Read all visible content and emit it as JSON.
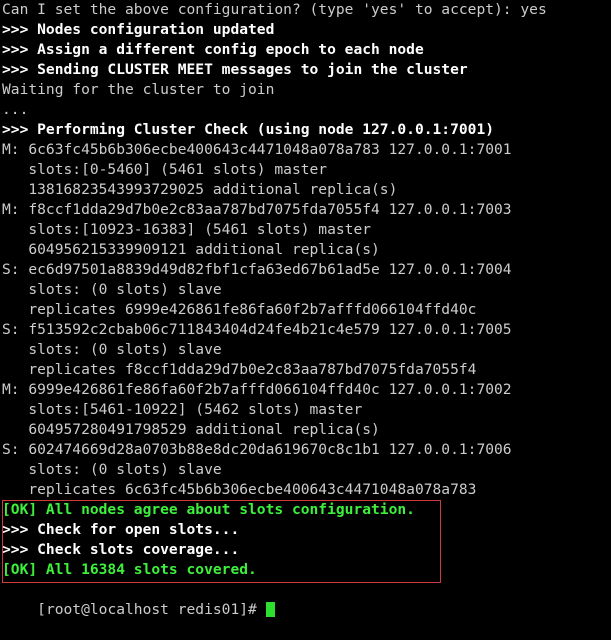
{
  "terminal": {
    "title": "redis-cluster-terminal",
    "background_color": "#000000",
    "default_text_color": "#cccccc",
    "bold_white_color": "#ffffff",
    "green_color": "#3cf03c",
    "highlight_border_color": "#d03a3a",
    "cursor_color": "#2ee02e",
    "lines": [
      {
        "id": "line-0",
        "style": "plain",
        "text": "Can I set the above configuration? (type 'yes' to accept): yes"
      },
      {
        "id": "line-1",
        "style": "white",
        "text": ">>> Nodes configuration updated"
      },
      {
        "id": "line-2",
        "style": "white",
        "text": ">>> Assign a different config epoch to each node"
      },
      {
        "id": "line-3",
        "style": "white",
        "text": ">>> Sending CLUSTER MEET messages to join the cluster"
      },
      {
        "id": "line-4",
        "style": "plain",
        "text": "Waiting for the cluster to join"
      },
      {
        "id": "line-5",
        "style": "plain",
        "text": "..."
      },
      {
        "id": "line-6",
        "style": "white",
        "text": ">>> Performing Cluster Check (using node 127.0.0.1:7001)"
      },
      {
        "id": "line-7",
        "style": "plain",
        "text": "M: 6c63fc45b6b306ecbe400643c4471048a078a783 127.0.0.1:7001"
      },
      {
        "id": "line-8",
        "style": "plain",
        "text": "   slots:[0-5460] (5461 slots) master"
      },
      {
        "id": "line-9",
        "style": "plain",
        "text": "   13816823543993729025 additional replica(s)"
      },
      {
        "id": "line-10",
        "style": "plain",
        "text": "M: f8ccf1dda29d7b0e2c83aa787bd7075fda7055f4 127.0.0.1:7003"
      },
      {
        "id": "line-11",
        "style": "plain",
        "text": "   slots:[10923-16383] (5461 slots) master"
      },
      {
        "id": "line-12",
        "style": "plain",
        "text": "   604956215339909121 additional replica(s)"
      },
      {
        "id": "line-13",
        "style": "plain",
        "text": "S: ec6d97501a8839d49d82fbf1cfa63ed67b61ad5e 127.0.0.1:7004"
      },
      {
        "id": "line-14",
        "style": "plain",
        "text": "   slots: (0 slots) slave"
      },
      {
        "id": "line-15",
        "style": "plain",
        "text": "   replicates 6999e426861fe86fa60f2b7afffd066104ffd40c"
      },
      {
        "id": "line-16",
        "style": "plain",
        "text": "S: f513592c2cbab06c711843404d24fe4b21c4e579 127.0.0.1:7005"
      },
      {
        "id": "line-17",
        "style": "plain",
        "text": "   slots: (0 slots) slave"
      },
      {
        "id": "line-18",
        "style": "plain",
        "text": "   replicates f8ccf1dda29d7b0e2c83aa787bd7075fda7055f4"
      },
      {
        "id": "line-19",
        "style": "plain",
        "text": "M: 6999e426861fe86fa60f2b7afffd066104ffd40c 127.0.0.1:7002"
      },
      {
        "id": "line-20",
        "style": "plain",
        "text": "   slots:[5461-10922] (5462 slots) master"
      },
      {
        "id": "line-21",
        "style": "plain",
        "text": "   604957280491798529 additional replica(s)"
      },
      {
        "id": "line-22",
        "style": "plain",
        "text": "S: 602474669d28a0703b88e8dc20da619670c8c1b1 127.0.0.1:7006"
      },
      {
        "id": "line-23",
        "style": "plain",
        "text": "   slots: (0 slots) slave"
      },
      {
        "id": "line-24",
        "style": "plain",
        "text": "   replicates 6c63fc45b6b306ecbe400643c4471048a078a783"
      },
      {
        "id": "line-25",
        "style": "green",
        "text": "[OK] All nodes agree about slots configuration."
      },
      {
        "id": "line-26",
        "style": "white",
        "text": ">>> Check for open slots..."
      },
      {
        "id": "line-27",
        "style": "white",
        "text": ">>> Check slots coverage..."
      },
      {
        "id": "line-28",
        "style": "green",
        "text": "[OK] All 16384 slots covered."
      }
    ],
    "prompt": {
      "text": "[root@localhost redis01]# ",
      "user": "root",
      "host": "localhost",
      "directory": "redis01",
      "symbol": "#"
    }
  }
}
